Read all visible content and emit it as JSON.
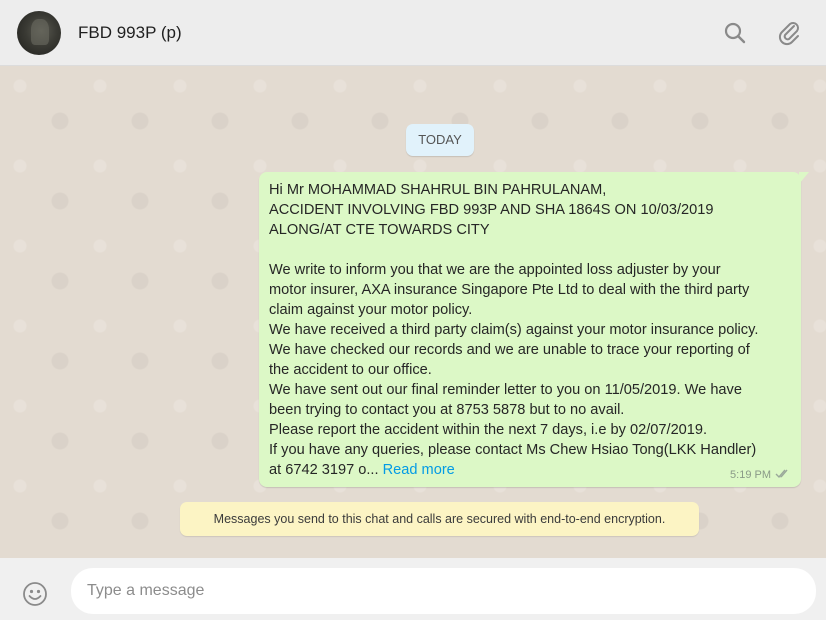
{
  "header": {
    "contact_name": "FBD 993P (p)",
    "icons": {
      "search": "search-icon",
      "attach": "paperclip-icon"
    }
  },
  "chat": {
    "date_chip": "TODAY",
    "message": {
      "text": "Hi Mr MOHAMMAD SHAHRUL BIN PAHRULANAM,\nACCIDENT INVOLVING FBD 993P AND SHA 1864S ON 10/03/2019\nALONG/AT CTE TOWARDS CITY\n\nWe write to inform you that we are the appointed loss adjuster by your\nmotor insurer, AXA insurance Singapore Pte Ltd to deal with the third party\nclaim against your motor policy.\nWe have received a third party claim(s) against your motor insurance policy.\nWe have checked our records and we are unable to trace your reporting of\nthe accident to our office.\nWe have sent out our final reminder letter to you on 11/05/2019. We have\nbeen trying to contact you at 8753 5878 but to no avail.\nPlease report the accident within the next 7 days, i.e by 02/07/2019.\nIf you have any queries, please contact Ms Chew Hsiao Tong(LKK Handler)\nat 6742 3197 o... ",
      "read_more": "Read more",
      "time": "5:19 PM",
      "status_icon": "double-check-icon"
    },
    "encryption_notice": "Messages you send to this chat and calls are secured with end-to-end encryption."
  },
  "footer": {
    "placeholder": "Type a message",
    "emoji_icon": "emoji-icon"
  },
  "colors": {
    "outgoing_bubble": "#dcf8c6",
    "date_chip": "#e1f2fb",
    "notice": "#fcf4c4",
    "link": "#039be5"
  }
}
